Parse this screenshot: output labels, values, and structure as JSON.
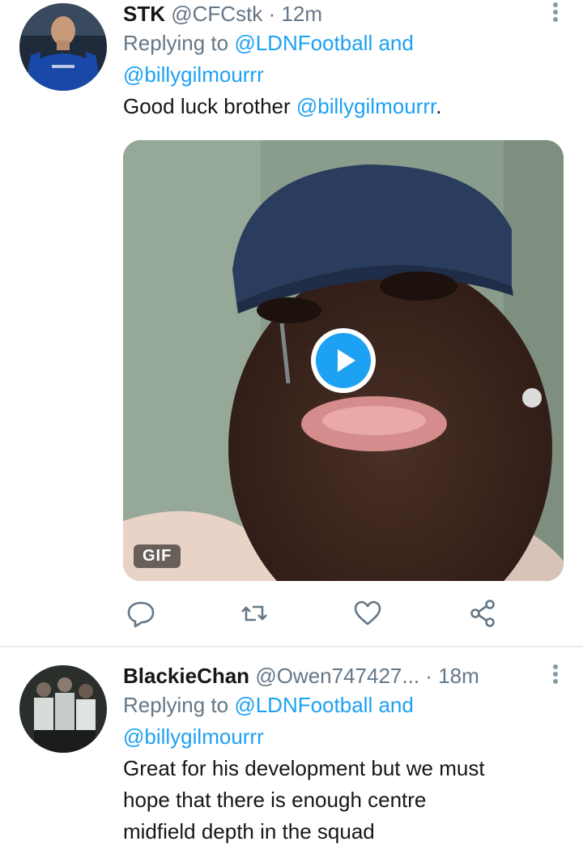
{
  "tweets": [
    {
      "name": "STK",
      "handle": "@CFCstk",
      "dot": "·",
      "time": "12m",
      "replying_prefix": "Replying to",
      "reply_mention_1": "@LDNFootball",
      "reply_and": "and",
      "reply_mention_2": "@billygilmourrr",
      "text_plain": "Good luck brother ",
      "text_mention": "@billygilmourrr",
      "text_suffix": ".",
      "media_badge": "GIF"
    },
    {
      "name": "BlackieChan",
      "handle": "@Owen747427...",
      "dot": "·",
      "time": "18m",
      "replying_prefix": "Replying to",
      "reply_mention_1": "@LDNFootball",
      "reply_and": "and",
      "reply_mention_2": "@billygilmourrr",
      "text_line_1": "Great for his development but we must",
      "text_line_2": "hope that there is enough centre",
      "text_line_3": "midfield depth in the squad"
    }
  ],
  "icons": {
    "reply": "reply-icon",
    "retweet": "retweet-icon",
    "like": "heart-icon",
    "share": "share-icon",
    "more": "more-options-icon",
    "play": "play-icon"
  },
  "colors": {
    "accent": "#1da1f2",
    "secondary_text": "#657786",
    "primary_text": "#14171a",
    "divider": "#e6ecf0"
  }
}
